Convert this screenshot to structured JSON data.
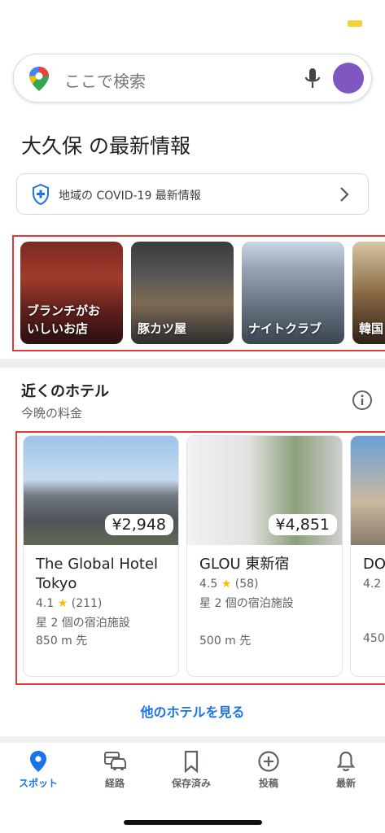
{
  "search": {
    "placeholder": "ここで検索"
  },
  "section_title": "大久保 の最新情報",
  "covid_banner": {
    "label": "地域の COVID-19 最新情報"
  },
  "categories": [
    {
      "label_line1": "ブランチがお",
      "label_line2": "いしいお店"
    },
    {
      "label_line1": "豚カツ屋",
      "label_line2": ""
    },
    {
      "label_line1": "ナイトクラブ",
      "label_line2": ""
    },
    {
      "label_line1": "韓国",
      "label_line2": ""
    }
  ],
  "hotels": {
    "heading": "近くのホテル",
    "subheading": "今晩の料金",
    "items": [
      {
        "price": "¥2,948",
        "name": "The Global Hotel Tokyo",
        "rating": "4.1",
        "reviews": "(211)",
        "class": "星 2 個の宿泊施設",
        "distance": "850 m 先"
      },
      {
        "price": "¥4,851",
        "name": "GLOU 東新宿",
        "rating": "4.5",
        "reviews": "(58)",
        "class": "星 2 個の宿泊施設",
        "distance": "500 m 先"
      },
      {
        "price": "",
        "name": "DO",
        "rating": "4.2",
        "reviews": "",
        "class": "",
        "distance": "450"
      }
    ],
    "more_label": "他のホテルを見る"
  },
  "nav": {
    "items": [
      {
        "label": "スポット",
        "icon": "pin-icon",
        "active": true
      },
      {
        "label": "経路",
        "icon": "car-icon",
        "active": false
      },
      {
        "label": "保存済み",
        "icon": "bookmark-icon",
        "active": false
      },
      {
        "label": "投稿",
        "icon": "add-circle-icon",
        "active": false
      },
      {
        "label": "最新",
        "icon": "bell-icon",
        "active": false
      }
    ]
  },
  "colors": {
    "accent": "#1a73e8",
    "star": "#fbbc04",
    "highlight_border": "#e53935",
    "avatar": "#7e57c2"
  }
}
